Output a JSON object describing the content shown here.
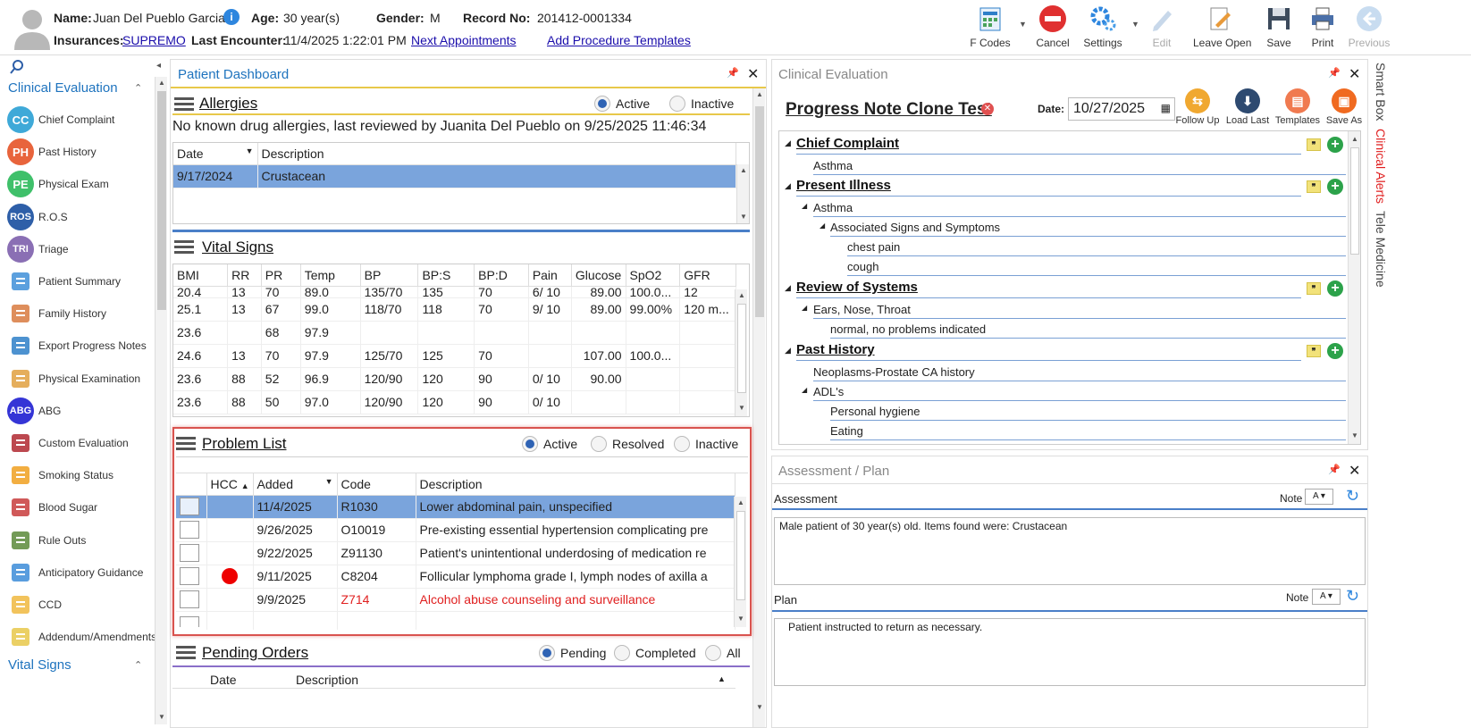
{
  "header": {
    "name_label": "Name:",
    "name": "Juan Del Pueblo Garcia",
    "age_label": "Age:",
    "age": "30 year(s)",
    "gender_label": "Gender:",
    "gender": "M",
    "record_label": "Record No:",
    "record": "201412-0001334",
    "ins_label": "Insurances:",
    "insurance": "SUPREMO",
    "last_label": "Last Encounter:",
    "last_encounter": "11/4/2025 1:22:01 PM",
    "next_appointments": "Next Appointments",
    "add_templates": "Add Procedure Templates"
  },
  "toolbar": {
    "fcodes": "F Codes",
    "cancel": "Cancel",
    "settings": "Settings",
    "edit": "Edit",
    "leave_open": "Leave Open",
    "save": "Save",
    "print": "Print",
    "previous": "Previous"
  },
  "leftnav": {
    "section1": "Clinical Evaluation",
    "items": [
      {
        "label": "Chief Complaint",
        "abbr": "CC",
        "color": "#3fa9d8"
      },
      {
        "label": "Past History",
        "abbr": "PH",
        "color": "#e8643c"
      },
      {
        "label": "Physical Exam",
        "abbr": "PE",
        "color": "#3fc06a"
      },
      {
        "label": "R.O.S",
        "abbr": "ROS",
        "color": "#2e5fa8"
      },
      {
        "label": "Triage",
        "abbr": "TRI",
        "color": "#8a6fb4"
      },
      {
        "label": "Patient Summary",
        "abbr": "",
        "color": "#3f8fd8"
      },
      {
        "label": "Family History",
        "abbr": "",
        "color": "#d87a3f"
      },
      {
        "label": "Export Progress Notes",
        "abbr": "",
        "color": "#2e7fc8"
      },
      {
        "label": "Physical Examination",
        "abbr": "",
        "color": "#e0a040"
      },
      {
        "label": "ABG",
        "abbr": "ABG",
        "color": "#3535d6"
      },
      {
        "label": "Custom Evaluation",
        "abbr": "",
        "color": "#b02830"
      },
      {
        "label": "Smoking Status",
        "abbr": "",
        "color": "#f0a020"
      },
      {
        "label": "Blood Sugar",
        "abbr": "",
        "color": "#c83c3c"
      },
      {
        "label": "Rule Outs",
        "abbr": "",
        "color": "#5a8a3a"
      },
      {
        "label": "Anticipatory Guidance",
        "abbr": "",
        "color": "#3c8cd8"
      },
      {
        "label": "CCD",
        "abbr": "",
        "color": "#f0b840"
      },
      {
        "label": "Addendum/Amendments",
        "abbr": "",
        "color": "#e8c84a"
      }
    ],
    "section2": "Vital Signs"
  },
  "dashboard": {
    "title": "Patient Dashboard",
    "allergies": {
      "title": "Allergies",
      "active": "Active",
      "inactive": "Inactive",
      "summary": "No known drug allergies, last reviewed by Juanita Del Pueblo on 9/25/2025 11:46:34",
      "cols": [
        "Date",
        "Description"
      ],
      "rows": [
        [
          "9/17/2024",
          "Crustacean"
        ]
      ]
    },
    "vitals": {
      "title": "Vital Signs",
      "cols": [
        "BMI",
        "RR",
        "PR",
        "Temp",
        "BP",
        "BP:S",
        "BP:D",
        "Pain",
        "Glucose",
        "SpO2",
        "GFR"
      ],
      "rows": [
        [
          "20.4",
          "13",
          "70",
          "89.0",
          "135/70",
          "135",
          "70",
          "6/ 10",
          "89.00",
          "100.0...",
          "12"
        ],
        [
          "25.1",
          "13",
          "67",
          "99.0",
          "118/70",
          "118",
          "70",
          "9/ 10",
          "89.00",
          "99.00%",
          "120 m..."
        ],
        [
          "23.6",
          "",
          "68",
          "97.9",
          "",
          "",
          "",
          "",
          "",
          "",
          ""
        ],
        [
          "24.6",
          "13",
          "70",
          "97.9",
          "125/70",
          "125",
          "70",
          "",
          "107.00",
          "100.0...",
          ""
        ],
        [
          "23.6",
          "88",
          "52",
          "96.9",
          "120/90",
          "120",
          "90",
          "0/ 10",
          "90.00",
          "",
          ""
        ],
        [
          "23.6",
          "88",
          "50",
          "97.0",
          "120/90",
          "120",
          "90",
          "0/ 10",
          "",
          "",
          ""
        ]
      ]
    },
    "problems": {
      "title": "Problem List",
      "active": "Active",
      "resolved": "Resolved",
      "inactive": "Inactive",
      "cols": [
        "HCC",
        "Added",
        "Code",
        "Description"
      ],
      "rows": [
        {
          "added": "11/4/2025",
          "code": "R1030",
          "desc": "Lower abdominal pain, unspecified",
          "sel": true,
          "red": false,
          "hcc": false
        },
        {
          "added": "9/26/2025",
          "code": "O10019",
          "desc": "Pre-existing essential hypertension complicating pre",
          "sel": false,
          "red": false,
          "hcc": false
        },
        {
          "added": "9/22/2025",
          "code": "Z91130",
          "desc": "Patient's unintentional underdosing of medication re",
          "sel": false,
          "red": false,
          "hcc": false
        },
        {
          "added": "9/11/2025",
          "code": "C8204",
          "desc": "Follicular lymphoma grade I, lymph nodes of axilla a",
          "sel": false,
          "red": false,
          "hcc": true
        },
        {
          "added": "9/9/2025",
          "code": "Z714",
          "desc": "Alcohol abuse counseling and surveillance",
          "sel": false,
          "red": true,
          "hcc": false
        }
      ]
    },
    "orders": {
      "title": "Pending Orders",
      "pending": "Pending",
      "completed": "Completed",
      "all": "All",
      "cols": [
        "Date",
        "Description"
      ]
    }
  },
  "clinical": {
    "title": "Clinical Evaluation",
    "note_title": "Progress Note Clone Test",
    "date_label": "Date:",
    "date": "10/27/2025",
    "buttons": {
      "follow_up": "Follow Up",
      "load_last": "Load Last",
      "templates": "Templates",
      "save_as": "Save As"
    },
    "tree": {
      "cc": "Chief Complaint",
      "cc1": "Asthma",
      "pi": "Present Illness",
      "pi1": "Asthma",
      "pi2": "Associated Signs and Symptoms",
      "pi3": "chest pain",
      "pi4": "cough",
      "ros": "Review of Systems",
      "ros1": "Ears, Nose, Throat",
      "ros2": "normal, no problems indicated",
      "ph": "Past History",
      "ph1": "Neoplasms-Prostate CA history",
      "ph2": "ADL's",
      "ph3": "Personal hygiene",
      "ph4": "Eating"
    }
  },
  "assessment": {
    "title": "Assessment / Plan",
    "assessment_label": "Assessment",
    "note_label": "Note",
    "assessment_text": "Male patient of 30 year(s) old. Items found were:  Crustacean",
    "plan_label": "Plan",
    "plan_text": "Patient instructed to return as necessary."
  },
  "side_tabs": {
    "smart_box": "Smart Box",
    "clinical_alerts": "Clinical Alerts",
    "tele_medicine": "Tele Medicine"
  }
}
